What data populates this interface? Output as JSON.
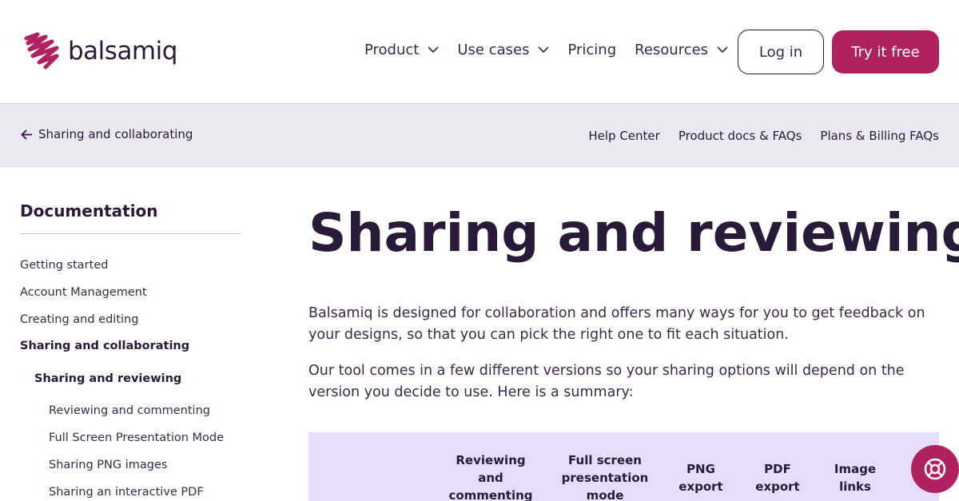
{
  "brand": {
    "name": "balsamiq",
    "accent": "#b0215f"
  },
  "header": {
    "nav": [
      {
        "label": "Product",
        "has_menu": true
      },
      {
        "label": "Use cases",
        "has_menu": true
      },
      {
        "label": "Pricing",
        "has_menu": false
      },
      {
        "label": "Resources",
        "has_menu": true
      }
    ],
    "login_label": "Log in",
    "try_label": "Try it free"
  },
  "subbar": {
    "back_label": "Sharing and collaborating",
    "links": [
      "Help Center",
      "Product docs & FAQs",
      "Plans & Billing FAQs"
    ]
  },
  "sidebar": {
    "title": "Documentation",
    "items": [
      {
        "label": "Getting started"
      },
      {
        "label": "Account Management"
      },
      {
        "label": "Creating and editing"
      },
      {
        "label": "Sharing and collaborating"
      },
      {
        "label": "Sharing and reviewing"
      },
      {
        "label": "Reviewing and commenting"
      },
      {
        "label": "Full Screen Presentation Mode"
      },
      {
        "label": "Sharing PNG images"
      },
      {
        "label": "Sharing an interactive PDF"
      }
    ]
  },
  "main": {
    "title": "Sharing and reviewing",
    "paragraphs": [
      "Balsamiq is designed for collaboration and offers many ways for you to get feedback on your designs, so that you can pick the right one to fit each situation.",
      "Our tool comes in a few different versions so your sharing options will depend on the version you decide to use. Here is a summary:"
    ],
    "table_headers": [
      "Reviewing and commenting",
      "Full screen presentation mode",
      "PNG export",
      "PDF export",
      "Image links"
    ]
  },
  "help_button_icon": "lifebuoy-icon"
}
